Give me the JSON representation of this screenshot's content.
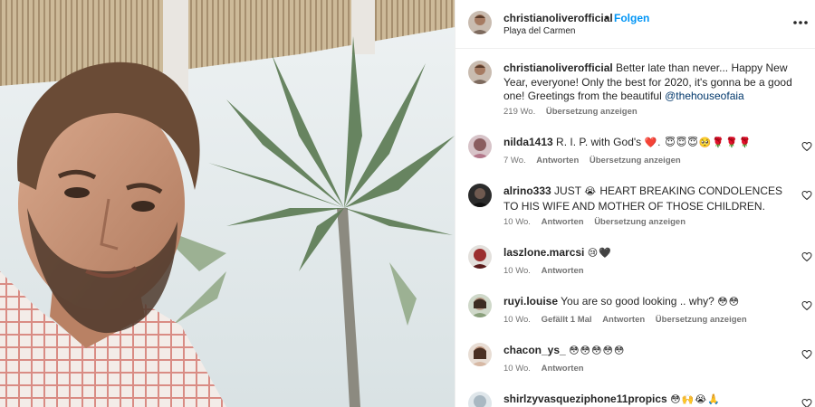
{
  "post": {
    "username": "christianoliverofficial",
    "separator": "•",
    "follow_label": "Folgen",
    "location": "Playa del Carmen",
    "more_icon": "more-horizontal-icon"
  },
  "caption": {
    "username": "christianoliverofficial",
    "text": "Better late than never... Happy New Year, everyone! Only the best for 2020, it's gonna be a good one! Greetings from the beautiful",
    "mention": "@thehouseofaia",
    "age": "219 Wo.",
    "translate": "Übersetzung anzeigen"
  },
  "comments": [
    {
      "username": "nilda1413",
      "text": "R. I. P. with God's",
      "emoji": "❤️. 😇😇😇🥺🌹🌹🌹",
      "age": "7 Wo.",
      "reply": "Antworten",
      "translate": "Übersetzung anzeigen"
    },
    {
      "username": "alrino333",
      "text_a": "JUST",
      "emoji": "😭",
      "text_b": "HEART BREAKING CONDOLENCES TO HIS WIFE AND MOTHER OF THOSE CHILDREN.",
      "age": "10 Wo.",
      "reply": "Antworten",
      "translate": "Übersetzung anzeigen"
    },
    {
      "username": "laszlone.marcsi",
      "emoji": "😢🖤",
      "age": "10 Wo.",
      "reply": "Antworten"
    },
    {
      "username": "ruyi.louise",
      "text": "You are so good looking .. why?",
      "emoji": "😳😳",
      "age": "10 Wo.",
      "likes": "Gefällt 1 Mal",
      "reply": "Antworten",
      "translate": "Übersetzung anzeigen"
    },
    {
      "username": "chacon_ys_",
      "emoji": "😳😳😳😳😳",
      "age": "10 Wo.",
      "reply": "Antworten"
    },
    {
      "username": "shirlzyvasqueziphone11propics",
      "emoji": "😳🙌😭🙏"
    }
  ],
  "colors": {
    "link": "#0095f6",
    "mention": "#00376b",
    "meta": "#737373",
    "text": "#262626"
  }
}
